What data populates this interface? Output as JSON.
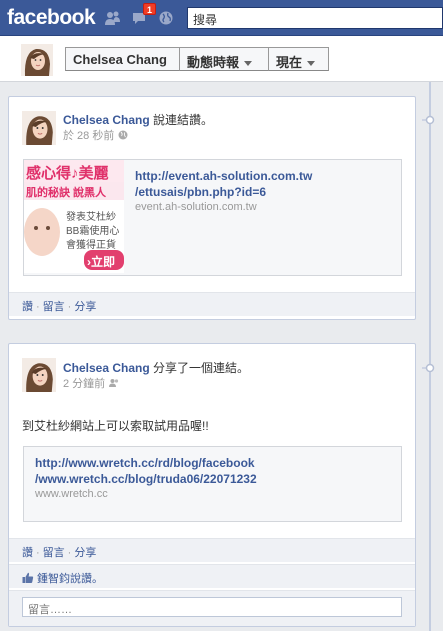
{
  "topbar": {
    "logo": "facebook",
    "notification_count": "1",
    "search_placeholder": "搜尋"
  },
  "timeline_header": {
    "name_button": "Chelsea Chang",
    "activity_button": "動態時報",
    "now_button": "現在"
  },
  "posts": [
    {
      "author": "Chelsea Chang",
      "action": " 說連結讚。",
      "time": "於 28 秒前",
      "link": {
        "url_line1": "http://event.ah-solution.com.tw",
        "url_line2": "/ettusais/pbn.php?id=6",
        "domain": "event.ah-solution.com.tw",
        "thumb_text1": "感心得♪美麗",
        "thumb_text2": "肌的秘訣 說黑人",
        "thumb_text3": "發表艾杜紗",
        "thumb_text4": "BB霜使用心",
        "thumb_text5": "會獲得正貨",
        "thumb_button": "›立即"
      },
      "actions": {
        "like": "讚",
        "comment": "留言",
        "share": "分享"
      }
    },
    {
      "author": "Chelsea Chang",
      "action": " 分享了一個連結。",
      "time": "2 分鐘前",
      "message": "到艾杜紗網站上可以索取試用品喔!!",
      "link": {
        "url_line1": "http://www.wretch.cc/rd/blog/facebook",
        "url_line2": "/www.wretch.cc/blog/truda06/22071232",
        "domain": "www.wretch.cc"
      },
      "actions": {
        "like": "讚",
        "comment": "留言",
        "share": "分享"
      },
      "likes_text": "鍾智鈞說讚。",
      "comment_placeholder": "留言……"
    }
  ],
  "colors": {
    "brand": "#3b5998",
    "background": "#e9ebee"
  }
}
